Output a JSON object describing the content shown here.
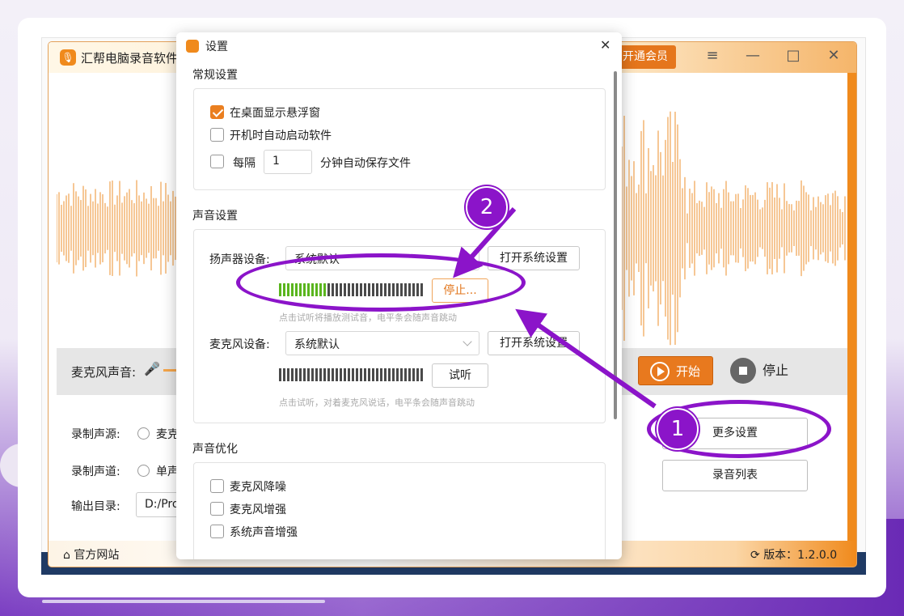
{
  "app": {
    "title": "汇帮电脑录音软件",
    "vip_label": "开通会员",
    "menu_icon": "≡",
    "minimize_icon": "—",
    "maximize_icon": "□",
    "close_icon": "✕",
    "mic_volume_label": "麦克风声音:",
    "start_label": "开始",
    "stop_label": "停止",
    "source_label": "录制声源:",
    "source_option": "麦克",
    "channel_label": "录制声道:",
    "channel_option": "单声",
    "output_label": "输出目录:",
    "output_value": "D:/Pro",
    "more_settings_label": "更多设置",
    "record_list_label": "录音列表",
    "footer_home": "官方网站",
    "footer_version": "版本：1.2.0.0",
    "accent": "#f08a1c"
  },
  "dialog": {
    "title": "设置",
    "close_icon": "✕",
    "general": {
      "title": "常规设置",
      "show_float": {
        "label": "在桌面显示悬浮窗",
        "checked": true
      },
      "auto_start": {
        "label": "开机时自动启动软件",
        "checked": false
      },
      "autosave_prefix": "每隔",
      "autosave_value": "1",
      "autosave_suffix": "分钟自动保存文件",
      "autosave_checked": false
    },
    "sound": {
      "title": "声音设置",
      "speaker_label": "扬声器设备:",
      "speaker_value": "系统默认",
      "open_system_label": "打开系统设置",
      "speaker_test_label": "停止...",
      "speaker_level": 0.34,
      "speaker_hint": "点击试听将播放测试音，电平条会随声音跳动",
      "mic_label": "麦克风设备:",
      "mic_value": "系统默认",
      "mic_test_label": "试听",
      "mic_level": 0,
      "mic_hint": "点击试听，对着麦克风说话，电平条会随声音跳动"
    },
    "optimize": {
      "title": "声音优化",
      "items": [
        {
          "label": "麦克风降噪",
          "checked": false
        },
        {
          "label": "麦克风增强",
          "checked": false
        },
        {
          "label": "系统声音增强",
          "checked": false
        }
      ]
    }
  },
  "annotations": {
    "badge1": "1",
    "badge2": "2",
    "color": "#8b14c9"
  }
}
